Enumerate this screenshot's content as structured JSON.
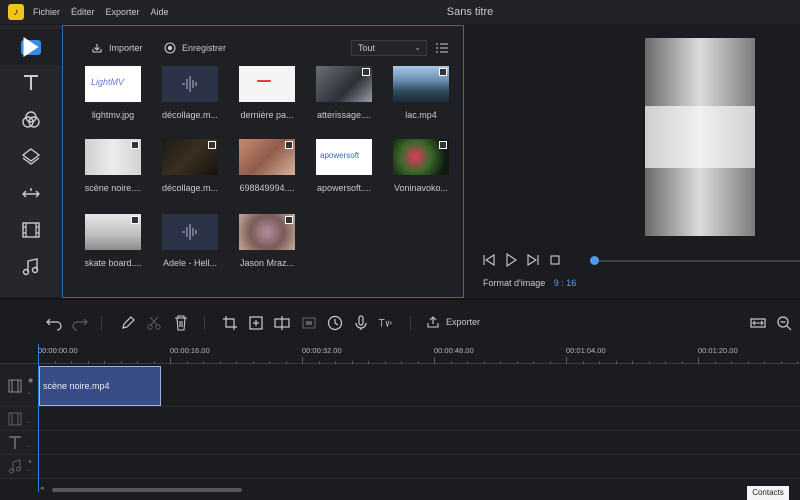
{
  "app": {
    "title": "Sans titre",
    "logo": "app-logo"
  },
  "menu": [
    "Fichier",
    "Éditer",
    "Exporter",
    "Aide"
  ],
  "nav": [
    {
      "name": "media",
      "icon": "play-icon"
    },
    {
      "name": "text",
      "icon": "text-icon"
    },
    {
      "name": "filters",
      "icon": "filters-icon"
    },
    {
      "name": "overlays",
      "icon": "layers-icon"
    },
    {
      "name": "transitions",
      "icon": "transitions-icon"
    },
    {
      "name": "elements",
      "icon": "film-icon"
    },
    {
      "name": "music",
      "icon": "music-icon"
    }
  ],
  "library": {
    "import_label": "Importer",
    "record_label": "Enregistrer",
    "filter_value": "Tout",
    "items": [
      {
        "label": "lightmv.jpg",
        "type": "logo",
        "logo_text": "LightMV"
      },
      {
        "label": "décollage.m...",
        "type": "audio"
      },
      {
        "label": "dernière pa...",
        "type": "white"
      },
      {
        "label": "atterissage....",
        "type": "video"
      },
      {
        "label": "lac.mp4",
        "type": "video"
      },
      {
        "label": "scène noire....",
        "type": "video"
      },
      {
        "label": "décollage.m...",
        "type": "video"
      },
      {
        "label": "698849994....",
        "type": "image"
      },
      {
        "label": "apowersoft....",
        "type": "logo",
        "logo_text": "apowersoft"
      },
      {
        "label": "Voninavoko...",
        "type": "video"
      },
      {
        "label": "skate board....",
        "type": "video"
      },
      {
        "label": "Adele - Hell...",
        "type": "audio"
      },
      {
        "label": "Jason Mraz...",
        "type": "image"
      }
    ]
  },
  "preview": {
    "aspect_label": "Format d'image",
    "aspect_value": "9 : 16",
    "progress": 0.0
  },
  "toolbar": {
    "export_label": "Exporter"
  },
  "ruler": {
    "labels": [
      "00:00:00.00",
      "00:00:16.00",
      "00:00:32.00",
      "00:00:48.00",
      "00:01:04.00",
      "00:01:20.00"
    ]
  },
  "timeline": {
    "clip_label": "scène noire.mp4"
  },
  "footer": {
    "contacts_label": "Contacts"
  },
  "colors": {
    "accent": "#3a8be5",
    "clip": "#384c85",
    "panel_border": "#2f6cb5"
  }
}
